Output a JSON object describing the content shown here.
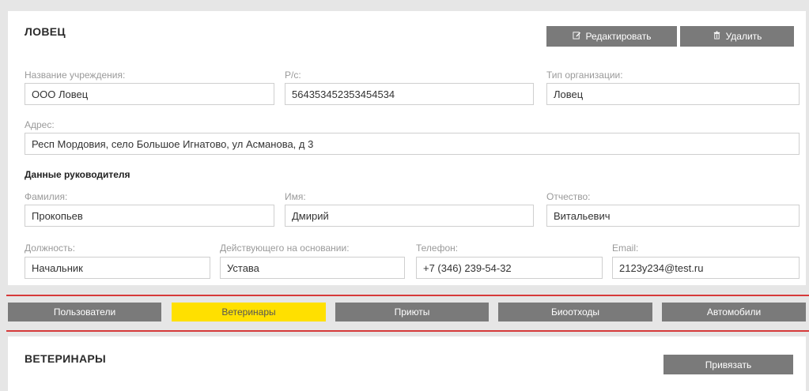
{
  "organization": {
    "title": "ЛОВЕЦ",
    "edit_label": "Редактировать",
    "delete_label": "Удалить",
    "fields": {
      "name_label": "Название учреждения:",
      "name_value": "ООО Ловец",
      "account_label": "Р/с:",
      "account_value": "564353452353454534",
      "org_type_label": "Тип организации:",
      "org_type_value": "Ловец",
      "address_label": "Адрес:",
      "address_value": "Респ Мордовия, село Большое Игнатово, ул Асманова, д 3"
    },
    "director": {
      "heading": "Данные руководителя",
      "surname_label": "Фамилия:",
      "surname_value": "Прокопьев",
      "name_label": "Имя:",
      "name_value": "Дмирий",
      "patronymic_label": "Отчество:",
      "patronymic_value": "Витальевич",
      "position_label": "Должность:",
      "position_value": "Начальник",
      "basis_label": "Действующего на основании:",
      "basis_value": "Устава",
      "phone_label": "Телефон:",
      "phone_value": "+7 (346) 239-54-32",
      "email_label": "Email:",
      "email_value": "2123y234@test.ru"
    }
  },
  "tabs": [
    {
      "label": "Пользователи",
      "active": false
    },
    {
      "label": "Ветеринары",
      "active": true
    },
    {
      "label": "Приюты",
      "active": false
    },
    {
      "label": "Биоотходы",
      "active": false
    },
    {
      "label": "Автомобили",
      "active": false
    }
  ],
  "vets": {
    "title": "ВЕТЕРИНАРЫ",
    "bind_label": "Привязать"
  },
  "icons": {
    "edit": "edit-icon",
    "delete": "trash-icon"
  },
  "colors": {
    "button_gray": "#7a7a7a",
    "active_tab": "#ffe000",
    "divider_red": "#d63a3a"
  }
}
